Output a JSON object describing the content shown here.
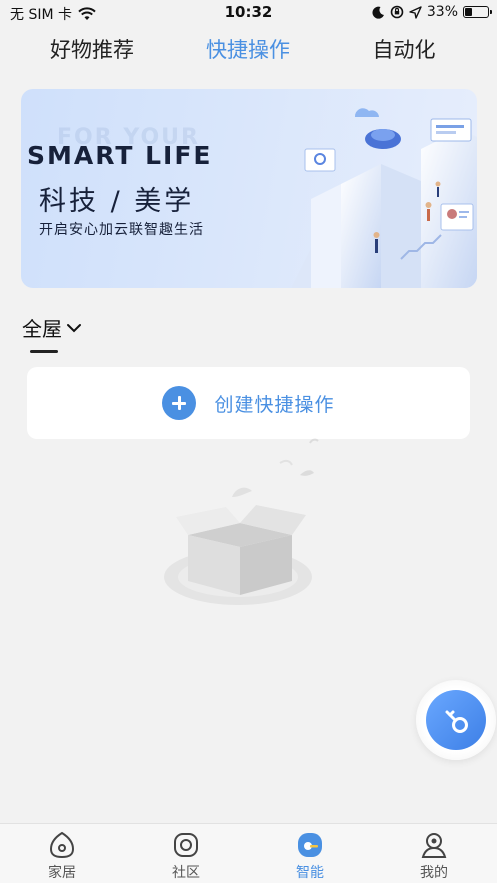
{
  "status_bar": {
    "carrier": "无 SIM 卡",
    "time": "10:32",
    "battery_percent": "33%",
    "battery_level": 0.33
  },
  "top_tabs": [
    {
      "label": "好物推荐",
      "active": false
    },
    {
      "label": "快捷操作",
      "active": true
    },
    {
      "label": "自动化",
      "active": false
    }
  ],
  "banner": {
    "ghost_text": "FOR YOUR",
    "title": "SMART LIFE",
    "subtitle": "科技 / 美学",
    "tagline": "开启安心加云联智趣生活"
  },
  "room_selector": {
    "label": "全屋"
  },
  "create_button": {
    "label": "创建快捷操作"
  },
  "bottom_nav": [
    {
      "label": "家居",
      "icon": "home-icon",
      "active": false
    },
    {
      "label": "社区",
      "icon": "community-icon",
      "active": false
    },
    {
      "label": "智能",
      "icon": "smart-icon",
      "active": true
    },
    {
      "label": "我的",
      "icon": "profile-icon",
      "active": false
    }
  ],
  "colors": {
    "accent": "#4a90e2",
    "background": "#f2f2f2"
  }
}
